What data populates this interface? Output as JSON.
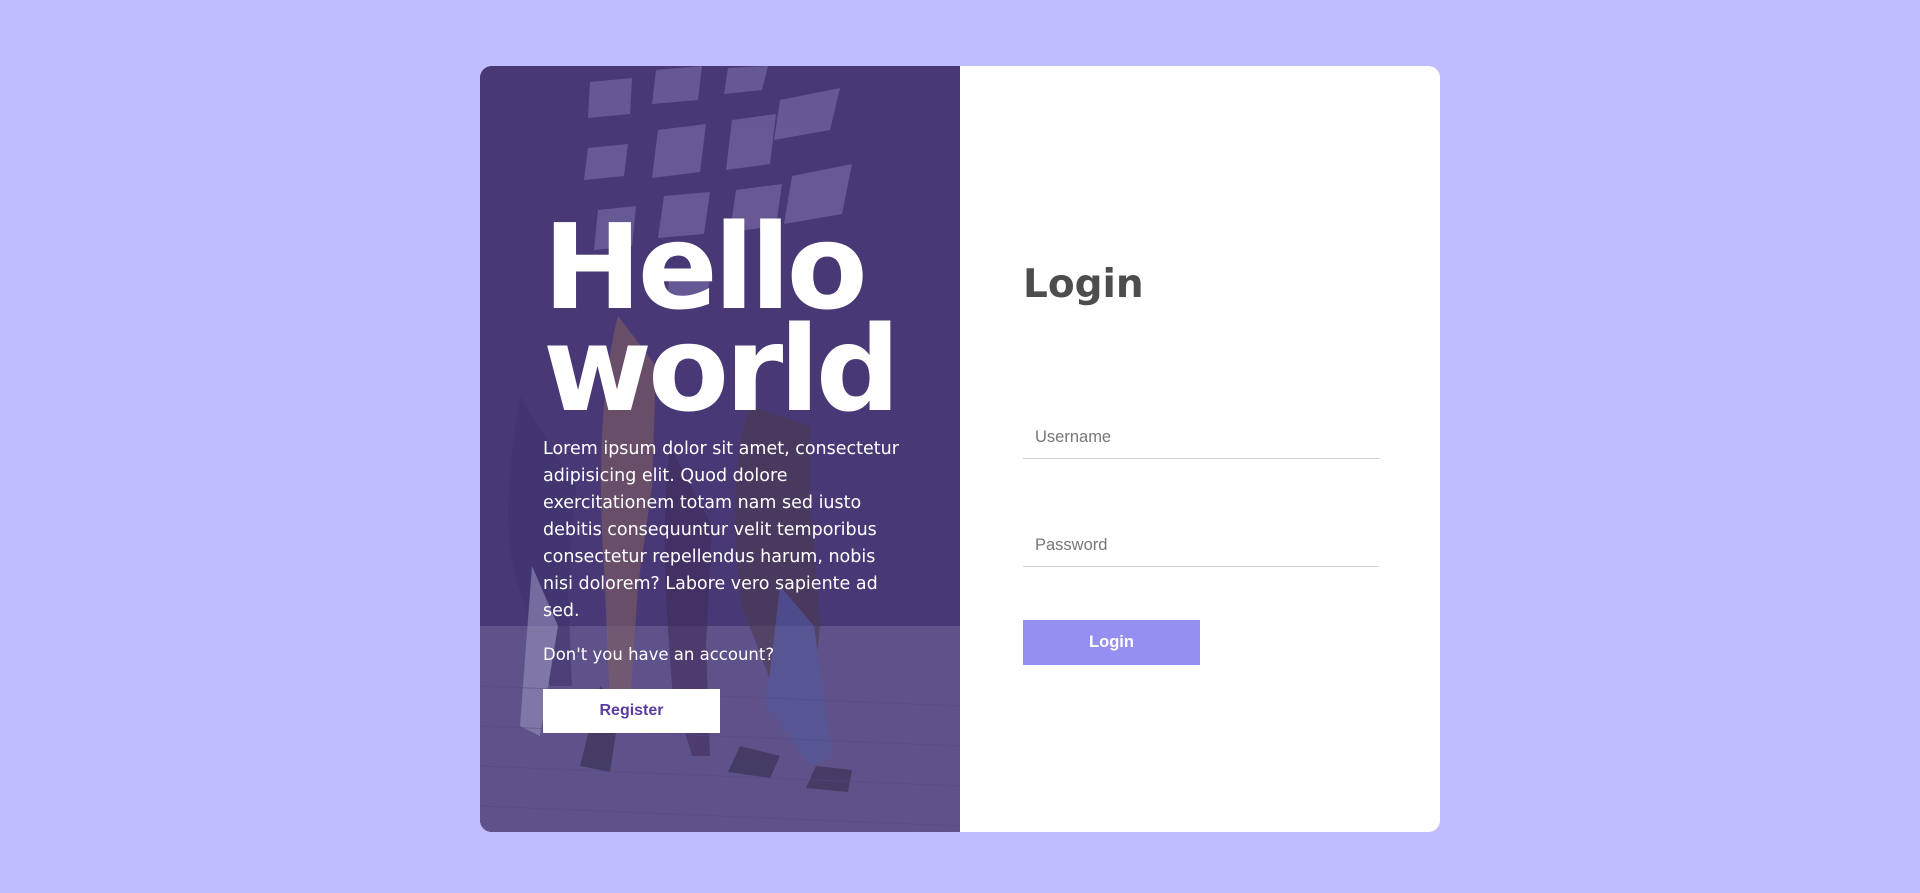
{
  "hero": {
    "title_line1": "Hello",
    "title_line2": "world",
    "text": "Lorem ipsum dolor sit amet, consectetur adipisicing elit. Quod dolore exercitationem totam nam sed iusto debitis consequuntur velit temporibus consectetur repellendus harum, nobis nisi dolorem? Labore vero sapiente ad sed.",
    "question": "Don't you have an account?",
    "register_label": "Register"
  },
  "login": {
    "title": "Login",
    "username_placeholder": "Username",
    "password_placeholder": "Password",
    "button_label": "Login"
  },
  "colors": {
    "page_background": "#c0bdff",
    "accent": "#948ff0",
    "register_text": "#5a3ba0",
    "title_text": "#4d4d4d"
  }
}
